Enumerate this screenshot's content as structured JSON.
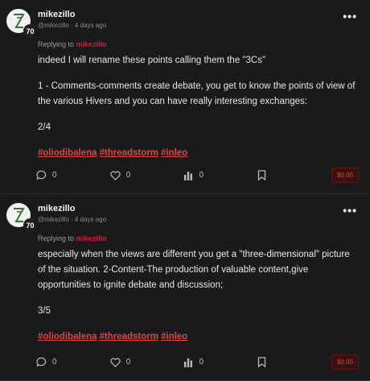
{
  "posts": [
    {
      "author": "mikezillo",
      "handle": "@mikezillo",
      "time": "4 days ago",
      "reputation": "70",
      "replying_label": "Replying to",
      "replying_to": "mikezillo",
      "paragraphs": [
        "indeed I will rename these points calling them the \"3Cs\"",
        "1 - Comments-comments create debate, you get to know the points of view of the various Hivers and you can have really interesting exchanges:",
        "2/4"
      ],
      "tags": [
        "#oliodibalena",
        "#threadstorm",
        "#inleo"
      ],
      "comments": "0",
      "likes": "0",
      "votes": "0",
      "payout": "$0.00"
    },
    {
      "author": "mikezillo",
      "handle": "@mikezillo",
      "time": "4 days ago",
      "reputation": "70",
      "replying_label": "Replying to",
      "replying_to": "mikezillo",
      "paragraphs": [
        "especially when the views are different you get a \"three-dimensional\" picture of the situation. 2-Content-The production of valuable content,give opportunities to ignite debate and discussion;",
        "3/5"
      ],
      "tags": [
        "#oliodibalena",
        "#threadstorm",
        "#inleo"
      ],
      "comments": "0",
      "likes": "0",
      "votes": "0",
      "payout": "$0.00"
    }
  ],
  "icons": {
    "comment": "comment-icon",
    "like": "heart-icon",
    "votes": "bar-chart-icon",
    "bookmark": "bookmark-icon",
    "more": "more-options-icon"
  },
  "colors": {
    "accent": "#e0443f",
    "background": "#1a1a1d"
  }
}
